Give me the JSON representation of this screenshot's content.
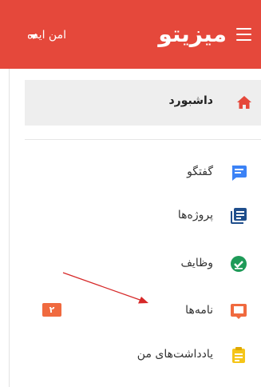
{
  "header": {
    "brand": "میزیتو",
    "workspace": "امن ایده",
    "color": "#e5483b"
  },
  "sidebar": {
    "dashboard": {
      "label": "داشبورد",
      "icon": "home-icon"
    },
    "items": [
      {
        "label": "گفتگو",
        "icon": "chat-icon",
        "color": "#3b82f6"
      },
      {
        "label": "پروژه‌ها",
        "icon": "projects-icon",
        "color": "#1f4e8c"
      },
      {
        "label": "وظایف",
        "icon": "tasks-check-icon",
        "color": "#1e9a58"
      },
      {
        "label": "نامه‌ها",
        "icon": "letters-icon",
        "color": "#f06a3f",
        "badge": "۲"
      },
      {
        "label": "یادداشت‌های من",
        "icon": "notes-clipboard-icon",
        "color": "#f5c518"
      }
    ]
  },
  "annotation": {
    "icon": "red-arrow-pointer"
  }
}
